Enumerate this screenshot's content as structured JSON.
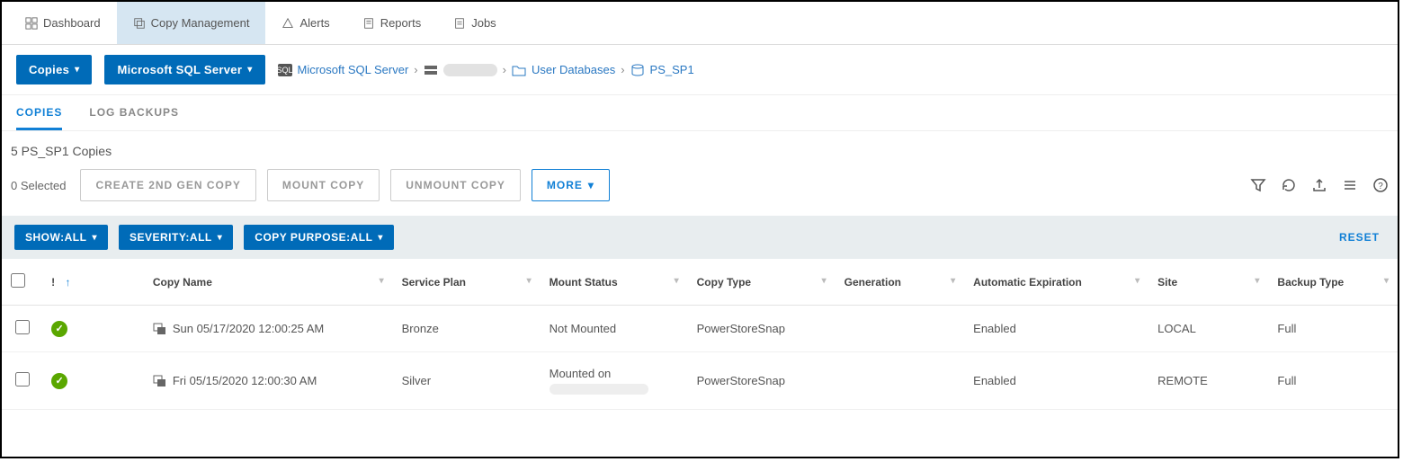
{
  "topnav": {
    "dashboard": "Dashboard",
    "copy_mgmt": "Copy Management",
    "alerts": "Alerts",
    "reports": "Reports",
    "jobs": "Jobs"
  },
  "subnav": {
    "copies_btn": "Copies",
    "server_btn": "Microsoft SQL Server"
  },
  "breadcrumb": {
    "root": "Microsoft SQL Server",
    "folder": "User Databases",
    "leaf": "PS_SP1"
  },
  "innertabs": {
    "copies": "COPIES",
    "log_backups": "LOG BACKUPS"
  },
  "count_line": "5 PS_SP1 Copies",
  "actions": {
    "selected": "0 Selected",
    "create": "CREATE 2ND GEN COPY",
    "mount": "MOUNT COPY",
    "unmount": "UNMOUNT COPY",
    "more": "MORE"
  },
  "filters": {
    "show": "SHOW:ALL",
    "severity": "SEVERITY:ALL",
    "purpose": "COPY PURPOSE:ALL",
    "reset": "RESET"
  },
  "columns": {
    "status": "!",
    "name": "Copy Name",
    "service_plan": "Service Plan",
    "mount_status": "Mount Status",
    "copy_type": "Copy Type",
    "generation": "Generation",
    "auto_exp": "Automatic Expiration",
    "site": "Site",
    "backup_type": "Backup Type"
  },
  "rows": [
    {
      "status": "ok",
      "name": "Sun 05/17/2020 12:00:25 AM",
      "service_plan": "Bronze",
      "mount_status": "Not Mounted",
      "mount_extra": "",
      "copy_type": "PowerStoreSnap",
      "generation": "",
      "auto_exp": "Enabled",
      "site": "LOCAL",
      "backup_type": "Full"
    },
    {
      "status": "ok",
      "name": "Fri 05/15/2020 12:00:30 AM",
      "service_plan": "Silver",
      "mount_status": "Mounted on",
      "mount_extra": "redacted",
      "copy_type": "PowerStoreSnap",
      "generation": "",
      "auto_exp": "Enabled",
      "site": "REMOTE",
      "backup_type": "Full"
    }
  ]
}
